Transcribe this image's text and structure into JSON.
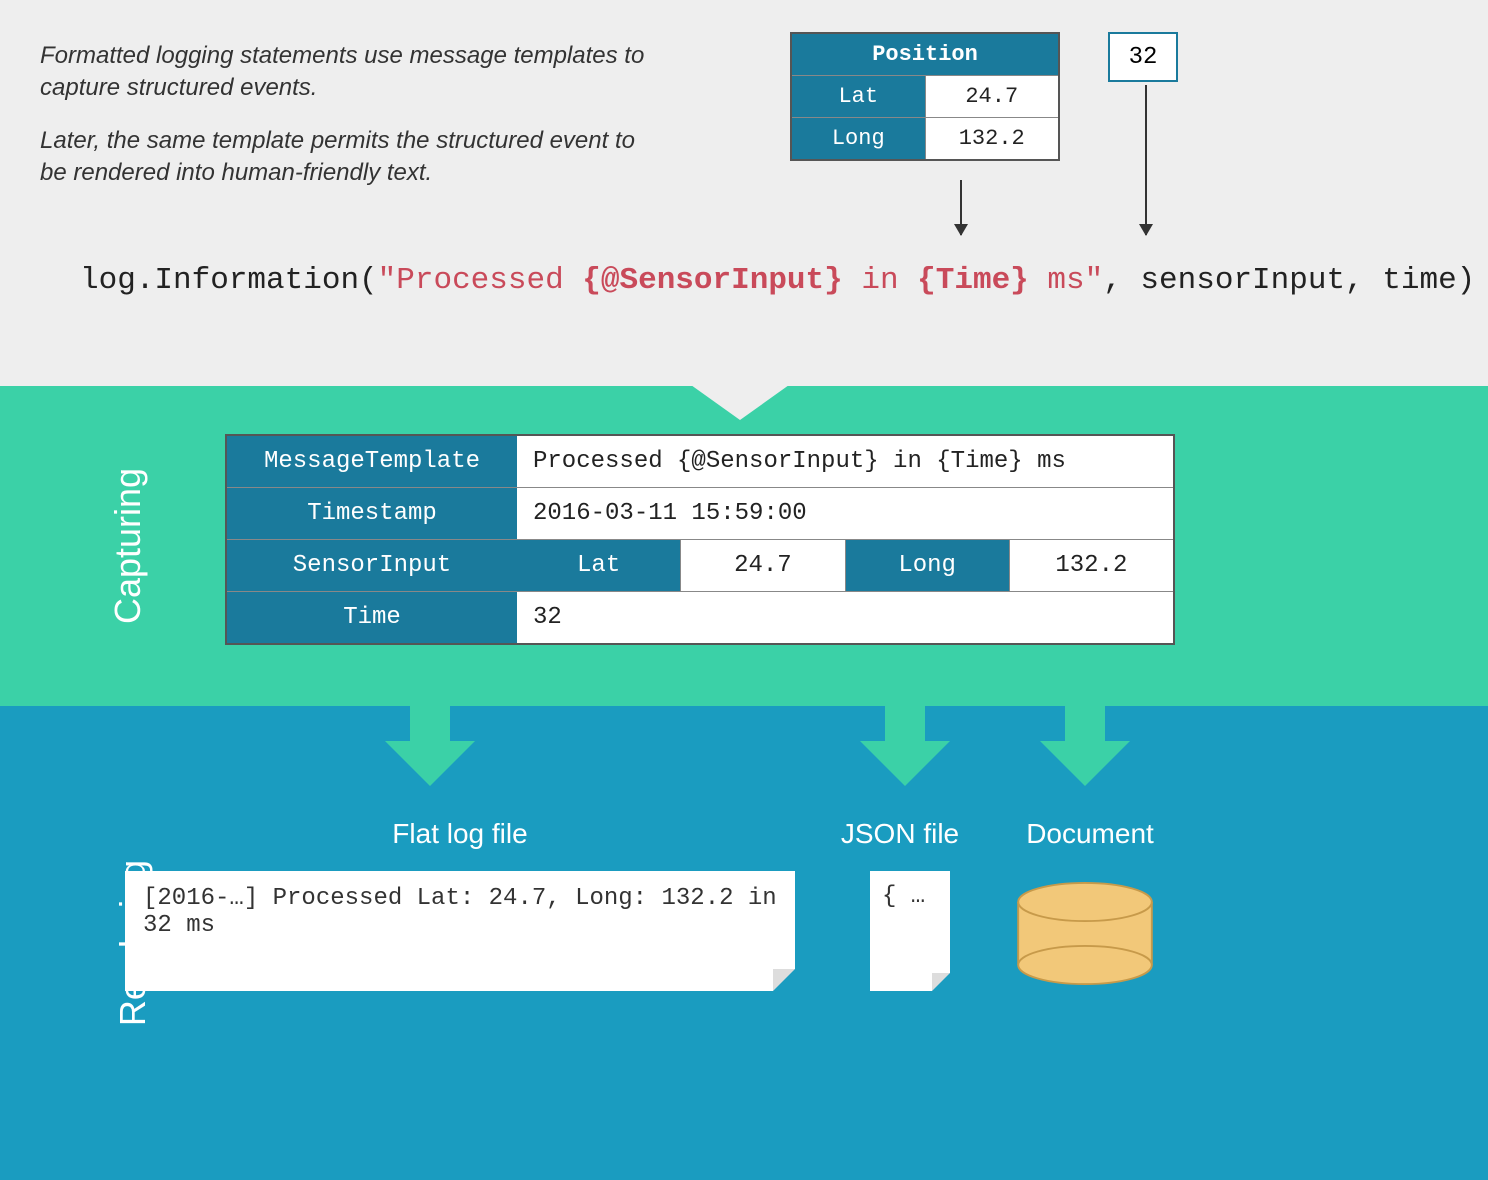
{
  "intro": {
    "p1": "Formatted logging statements use message templates to capture structured events.",
    "p2": "Later, the same template permits the structured event to be rendered into human-friendly text."
  },
  "position": {
    "header": "Position",
    "lat_label": "Lat",
    "lat_value": "24.7",
    "long_label": "Long",
    "long_value": "132.2"
  },
  "time_box": "32",
  "code": {
    "prefix": "log.Information(",
    "str_open": "\"Processed ",
    "token1": "{@SensorInput}",
    "str_mid": " in ",
    "token2": "{Time}",
    "str_end": " ms\"",
    "suffix": ", sensorInput, time)"
  },
  "sections": {
    "capturing": "Capturing",
    "rendering": "Rendering"
  },
  "capture": {
    "rows": {
      "mt_label": "MessageTemplate",
      "mt_value": "Processed {@SensorInput} in {Time} ms",
      "ts_label": "Timestamp",
      "ts_value": "2016-03-11 15:59:00",
      "si_label": "SensorInput",
      "si_lat_l": "Lat",
      "si_lat_v": "24.7",
      "si_long_l": "Long",
      "si_long_v": "132.2",
      "time_label": "Time",
      "time_value": "32"
    }
  },
  "render": {
    "flat_label": "Flat log file",
    "json_label": "JSON file",
    "doc_label": "Document",
    "flat_content": "[2016-…] Processed Lat: 24.7, Long: 132.2 in 32 ms",
    "json_content": "{ …"
  }
}
